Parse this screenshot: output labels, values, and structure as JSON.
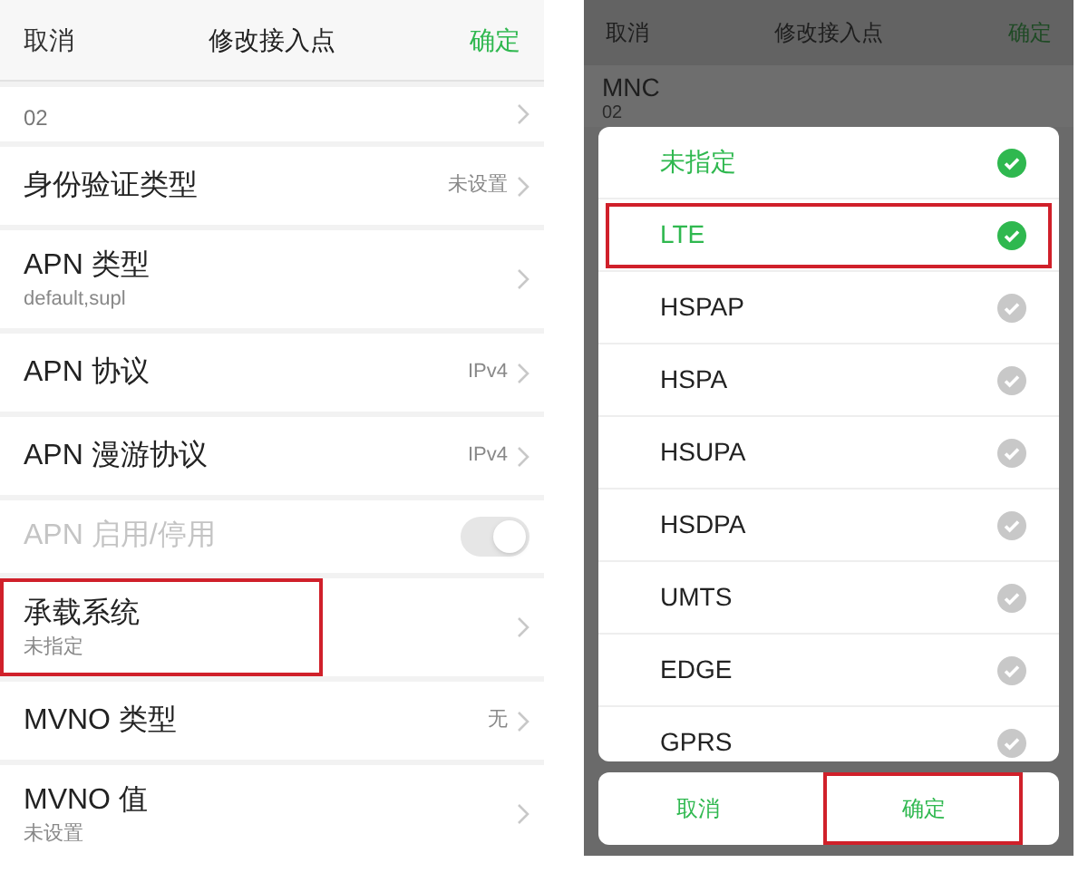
{
  "left_screen": {
    "header": {
      "cancel": "取消",
      "title": "修改接入点",
      "confirm": "确定"
    },
    "rows": [
      {
        "kind": "partial",
        "subtitle": "02",
        "highlighted": false
      },
      {
        "kind": "value",
        "title": "身份验证类型",
        "value": "未设置",
        "highlighted": false
      },
      {
        "kind": "subtitle",
        "title": "APN 类型",
        "subtitle": "default,supl",
        "highlighted": false
      },
      {
        "kind": "value",
        "title": "APN 协议",
        "value": "IPv4",
        "highlighted": false
      },
      {
        "kind": "value",
        "title": "APN 漫游协议",
        "value": "IPv4",
        "highlighted": false
      },
      {
        "kind": "toggle",
        "title": "APN 启用/停用",
        "on": true,
        "disabled": true,
        "highlighted": false
      },
      {
        "kind": "subtitle",
        "title": "承载系统",
        "subtitle": "未指定",
        "highlighted": true
      },
      {
        "kind": "value",
        "title": "MVNO 类型",
        "value": "无",
        "highlighted": false
      },
      {
        "kind": "subtitle",
        "title": "MVNO 值",
        "subtitle": "未设置",
        "highlighted": false
      }
    ]
  },
  "right_screen": {
    "header": {
      "cancel": "取消",
      "title": "修改接入点",
      "confirm": "确定"
    },
    "background_row": {
      "title": "MNC",
      "subtitle": "02"
    },
    "dialog": {
      "options": [
        {
          "label": "未指定",
          "selected": true,
          "highlighted": false
        },
        {
          "label": "LTE",
          "selected": true,
          "highlighted": true
        },
        {
          "label": "HSPAP",
          "selected": false,
          "highlighted": false
        },
        {
          "label": "HSPA",
          "selected": false,
          "highlighted": false
        },
        {
          "label": "HSUPA",
          "selected": false,
          "highlighted": false
        },
        {
          "label": "HSDPA",
          "selected": false,
          "highlighted": false
        },
        {
          "label": "UMTS",
          "selected": false,
          "highlighted": false
        },
        {
          "label": "EDGE",
          "selected": false,
          "highlighted": false
        },
        {
          "label": "GPRS",
          "selected": false,
          "highlighted": false
        }
      ],
      "buttons": [
        {
          "label": "取消",
          "highlighted": false
        },
        {
          "label": "确定",
          "highlighted": true
        }
      ]
    }
  }
}
